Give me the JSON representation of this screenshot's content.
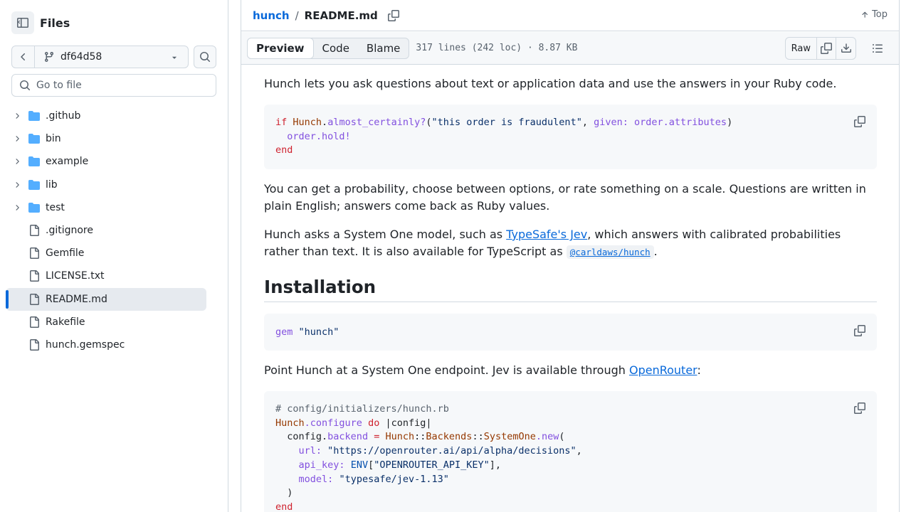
{
  "sidebar": {
    "title": "Files",
    "branch": "df64d58",
    "goto_placeholder": "Go to file",
    "items": [
      {
        "label": ".github",
        "type": "folder"
      },
      {
        "label": "bin",
        "type": "folder"
      },
      {
        "label": "example",
        "type": "folder"
      },
      {
        "label": "lib",
        "type": "folder"
      },
      {
        "label": "test",
        "type": "folder"
      },
      {
        "label": ".gitignore",
        "type": "file"
      },
      {
        "label": "Gemfile",
        "type": "file"
      },
      {
        "label": "LICENSE.txt",
        "type": "file"
      },
      {
        "label": "README.md",
        "type": "file",
        "selected": true
      },
      {
        "label": "Rakefile",
        "type": "file"
      },
      {
        "label": "hunch.gemspec",
        "type": "file"
      }
    ]
  },
  "header": {
    "repo": "hunch",
    "separator": "/",
    "file": "README.md",
    "top_label": "Top"
  },
  "toolbar": {
    "tabs": [
      "Preview",
      "Code",
      "Blame"
    ],
    "active_tab": "Preview",
    "meta": "317 lines (242 loc) · 8.87 KB",
    "raw_label": "Raw"
  },
  "readme": {
    "intro": "Hunch lets you ask questions about text or application data and use the answers in your Ruby code.",
    "code1": {
      "line1": {
        "k1": "if",
        "c1": "Hunch",
        "d1": ".",
        "f1": "almost_certainly?",
        "p1": "(",
        "s1": "\"this order is fraudulent\"",
        "p2": ", ",
        "f2": "given:",
        "p3": " ",
        "f3": "order.attributes",
        "p4": ")"
      },
      "line2": {
        "f1": "order.hold!"
      },
      "line3": {
        "k1": "end"
      }
    },
    "para2": "You can get a probability, choose between options, or rate something on a scale. Questions are written in plain English; answers come back as Ruby values.",
    "para3_before": "Hunch asks a System One model, such as ",
    "para3_link": "TypeSafe's Jev",
    "para3_middle": ", which answers with calibrated probabilities rather than text. It is also available for TypeScript as ",
    "para3_code": "@carldaws/hunch",
    "para3_after": ".",
    "installation_heading": "Installation",
    "code2": {
      "f1": "gem",
      "s1": "\"hunch\""
    },
    "para4_before": "Point Hunch at a System One endpoint. Jev is available through ",
    "para4_link": "OpenRouter",
    "para4_after": ":",
    "code3": {
      "comment": "# config/initializers/hunch.rb",
      "l2_c": "Hunch",
      "l2_f": ".configure",
      "l2_k": "do",
      "l2_p": "|config|",
      "l3_p": "config.",
      "l3_f": "backend",
      "l3_k": "=",
      "l3_c1": "Hunch",
      "l3_d1": "::",
      "l3_c2": "Backends",
      "l3_d2": "::",
      "l3_c3": "SystemOne",
      "l3_f2": ".new",
      "l3_p2": "(",
      "l4_f": "url:",
      "l4_s": "\"https://openrouter.ai/api/alpha/decisions\"",
      "l4_p": ",",
      "l5_f": "api_key:",
      "l5_c": "ENV",
      "l5_p1": "[",
      "l5_s": "\"OPENROUTER_API_KEY\"",
      "l5_p2": "],",
      "l6_f": "model:",
      "l6_s": "\"typesafe/jev-1.13\"",
      "l7_p": ")",
      "l8_k": "end"
    }
  }
}
